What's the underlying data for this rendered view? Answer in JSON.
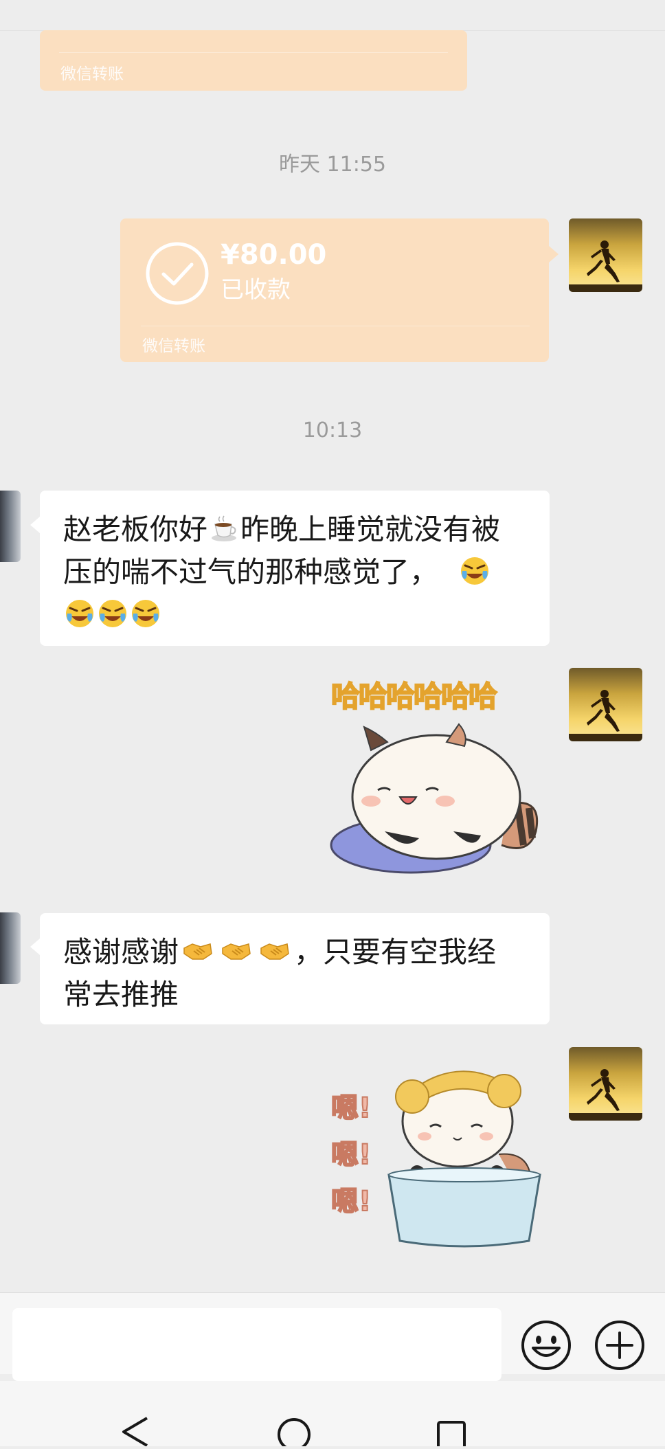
{
  "chat": {
    "top_transfer": {
      "label": "微信转账"
    },
    "timestamp_1": "昨天 11:55",
    "transfer": {
      "amount": "¥80.00",
      "status": "已收款",
      "label": "微信转账"
    },
    "timestamp_2": "10:13",
    "message_1": {
      "line1": "赵老板你好",
      "line1b": "昨晚上睡觉就没有被",
      "line2": "压的喘不过气的那种感觉了，",
      "line3": ""
    },
    "sticker_1": {
      "caption": "哈哈哈哈哈哈"
    },
    "message_2": {
      "line1a": "感谢感谢",
      "line1b": "，只要有空我经",
      "line2": "常去推推"
    },
    "sticker_2": {
      "caption_lines": [
        "嗯!",
        "嗯!",
        "嗯!"
      ]
    }
  },
  "icons": {
    "emoji_button": "emoji-face-icon",
    "plus_button": "plus-circle-icon",
    "nav_back": "triangle-back-icon",
    "nav_home": "circle-home-icon",
    "nav_recent": "square-recent-icon"
  },
  "colors": {
    "background": "#ededed",
    "transfer_bubble": "#fbdfc0",
    "text_bubble": "#ffffff",
    "timestamp": "#9a9a9a"
  }
}
